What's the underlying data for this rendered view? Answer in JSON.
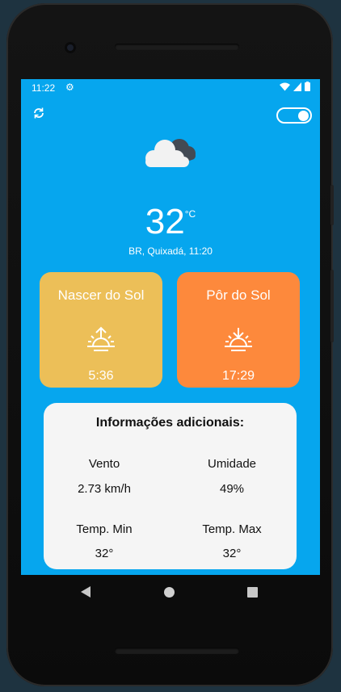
{
  "status_bar": {
    "time": "11:22"
  },
  "weather": {
    "temperature": "32",
    "unit": "°C",
    "location_time": "BR, Quixadá, 11:20",
    "icon": "cloud-icon"
  },
  "sunrise": {
    "label": "Nascer do Sol",
    "time": "5:36",
    "icon": "sunrise-icon",
    "color": "#ecbf58"
  },
  "sunset": {
    "label": "Pôr do Sol",
    "time": "17:29",
    "icon": "sunset-icon",
    "color": "#fd893c"
  },
  "info": {
    "title": "Informações adicionais:",
    "wind": {
      "label": "Vento",
      "value": "2.73 km/h"
    },
    "humidity": {
      "label": "Umidade",
      "value": "49%"
    },
    "temp_min": {
      "label": "Temp. Min",
      "value": "32°"
    },
    "temp_max": {
      "label": "Temp. Max",
      "value": "32°"
    }
  },
  "colors": {
    "background": "#06a6ee"
  },
  "toggle": {
    "state": "on"
  }
}
